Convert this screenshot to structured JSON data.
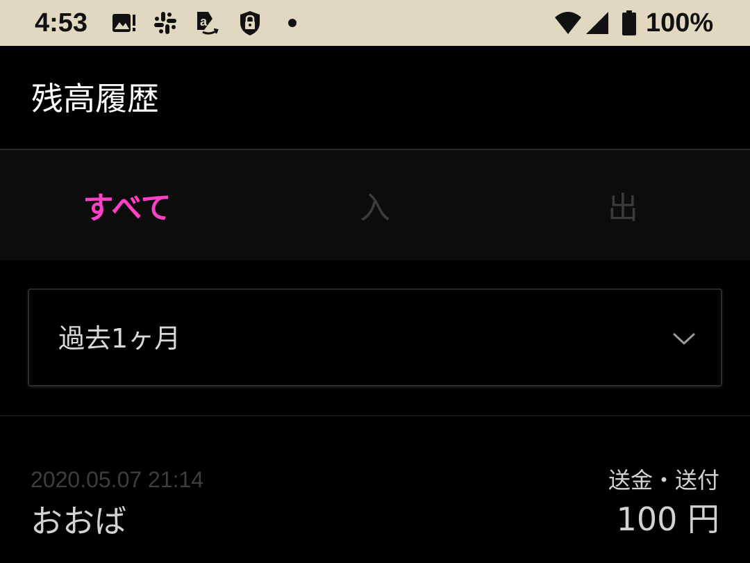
{
  "status_bar": {
    "time": "4:53",
    "battery_percent": "100%",
    "icons": [
      "photo-alert-icon",
      "slack-icon",
      "amazon-icon",
      "lock-icon",
      "dot-icon",
      "wifi-icon",
      "signal-icon",
      "battery-icon"
    ]
  },
  "header": {
    "title": "残高履歴"
  },
  "tabs": [
    {
      "label": "すべて",
      "selected": true
    },
    {
      "label": "入",
      "selected": false
    },
    {
      "label": "出",
      "selected": false
    }
  ],
  "period_filter": {
    "selected": "過去1ヶ月",
    "icon": "chevron-down-icon"
  },
  "transactions": [
    {
      "datetime": "2020.05.07 21:14",
      "name": "おおば",
      "type": "送金・送付",
      "amount": "100 円"
    }
  ],
  "colors": {
    "status_bar_bg": "#e0d8c0",
    "accent": "#ff3fc5",
    "background": "#000000",
    "tab_bar_bg": "#0c0c0c"
  }
}
